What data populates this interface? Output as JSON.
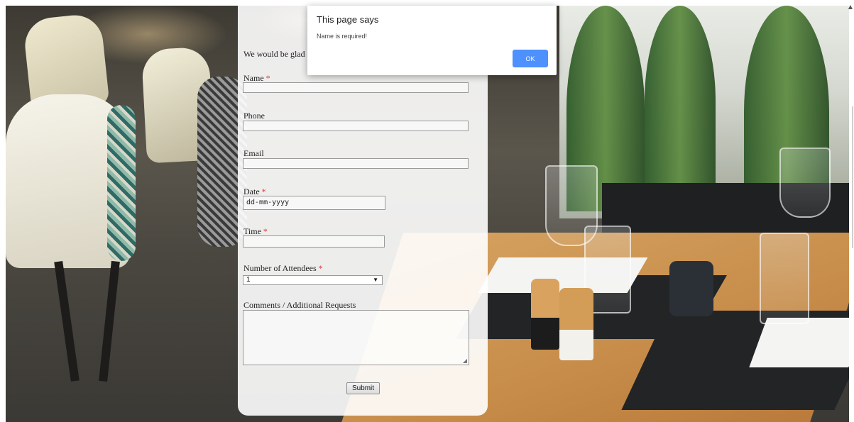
{
  "dialog": {
    "title": "This page says",
    "message": "Name is required!",
    "ok_label": "OK"
  },
  "form": {
    "intro": "We would be glad",
    "required_mark": "*",
    "fields": {
      "name": {
        "label": "Name",
        "value": ""
      },
      "phone": {
        "label": "Phone",
        "value": ""
      },
      "email": {
        "label": "Email",
        "value": ""
      },
      "date": {
        "label": "Date",
        "value": "dd-mm-yyyy"
      },
      "time": {
        "label": "Time",
        "value": ""
      },
      "attendees": {
        "label": "Number of Attendees",
        "selected": "1"
      },
      "comments": {
        "label": "Comments / Additional Requests",
        "value": ""
      }
    },
    "submit_label": "Submit"
  },
  "colors": {
    "required": "#dd3333",
    "ok_button": "#4d90fe",
    "card_background": "rgba(255,255,255,0.9)"
  },
  "icons": {
    "select_arrow": "chevron-down-icon",
    "scroll_up": "scroll-up-arrow-icon",
    "resize": "resize-grip-icon"
  }
}
